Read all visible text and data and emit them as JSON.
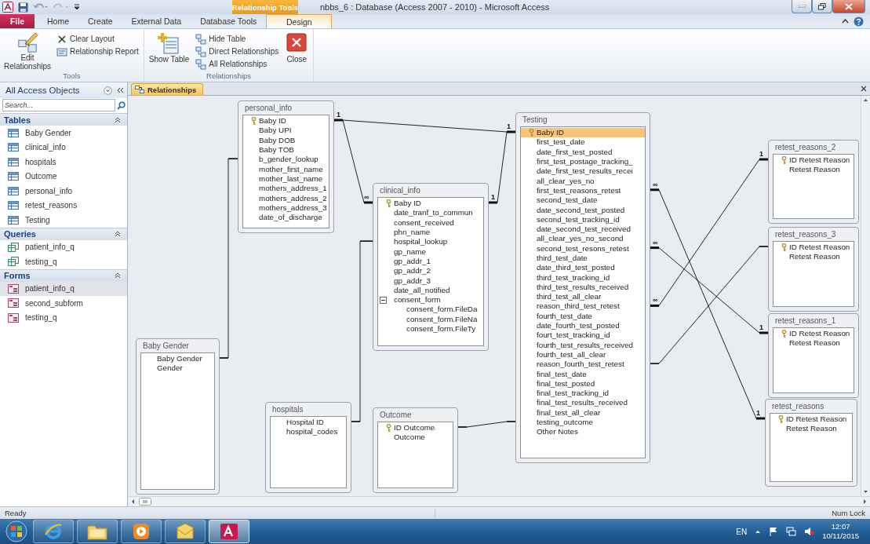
{
  "window": {
    "title": "nbbs_6 : Database (Access 2007 - 2010) - Microsoft Access",
    "context_tab_group": "Relationship Tools"
  },
  "ribbon_tabs": [
    {
      "label": "File",
      "kind": "file",
      "selected": false
    },
    {
      "label": "Home",
      "kind": "plain",
      "selected": false
    },
    {
      "label": "Create",
      "kind": "plain",
      "selected": false
    },
    {
      "label": "External Data",
      "kind": "plain",
      "selected": false
    },
    {
      "label": "Database Tools",
      "kind": "plain",
      "selected": false
    },
    {
      "label": "Design",
      "kind": "contextual",
      "selected": true
    }
  ],
  "ribbon_groups": [
    {
      "label": "Tools",
      "buttons": [
        {
          "label": "Edit Relationships",
          "kind": "large"
        },
        {
          "label": "Clear Layout",
          "kind": "small"
        },
        {
          "label": "Relationship Report",
          "kind": "small"
        }
      ]
    },
    {
      "label": "Relationships",
      "buttons": [
        {
          "label": "Show Table",
          "kind": "large"
        },
        {
          "label": "Hide Table",
          "kind": "small"
        },
        {
          "label": "Direct Relationships",
          "kind": "small"
        },
        {
          "label": "All Relationships",
          "kind": "small"
        },
        {
          "label": "Close",
          "kind": "large"
        }
      ]
    }
  ],
  "navigation": {
    "title": "All Access Objects",
    "search": {
      "placeholder": "Search..."
    },
    "groups": [
      {
        "label": "Tables",
        "kind": "table",
        "expanded": true,
        "items": [
          {
            "label": "Baby Gender",
            "selected": false
          },
          {
            "label": "clinical_info",
            "selected": false
          },
          {
            "label": "hospitals",
            "selected": false
          },
          {
            "label": "Outcome",
            "selected": false
          },
          {
            "label": "personal_info",
            "selected": false
          },
          {
            "label": "retest_reasons",
            "selected": false
          },
          {
            "label": "Testing",
            "selected": false
          }
        ]
      },
      {
        "label": "Queries",
        "kind": "query",
        "expanded": true,
        "items": [
          {
            "label": "patient_info_q",
            "selected": false
          },
          {
            "label": "testing_q",
            "selected": false
          }
        ]
      },
      {
        "label": "Forms",
        "kind": "form",
        "expanded": true,
        "items": [
          {
            "label": "patient_info_q",
            "selected": true
          },
          {
            "label": "second_subform",
            "selected": false
          },
          {
            "label": "testing_q",
            "selected": false
          }
        ]
      }
    ]
  },
  "document_tab": {
    "label": "Relationships"
  },
  "tables": [
    {
      "name": "personal_info",
      "fields": [
        {
          "name": "Baby ID",
          "key": true,
          "selected": false
        },
        {
          "name": "Baby UPI",
          "key": false,
          "selected": false
        },
        {
          "name": "Baby DOB",
          "key": false,
          "selected": false
        },
        {
          "name": "Baby TOB",
          "key": false,
          "selected": false
        },
        {
          "name": "b_gender_lookup",
          "key": false,
          "selected": false
        },
        {
          "name": "mother_first_name",
          "key": false,
          "selected": false
        },
        {
          "name": "mother_last_name",
          "key": false,
          "selected": false
        },
        {
          "name": "mothers_address_1",
          "key": false,
          "selected": false
        },
        {
          "name": "mothers_address_2",
          "key": false,
          "selected": false
        },
        {
          "name": "mothers_address_3",
          "key": false,
          "selected": false
        },
        {
          "name": "date_of_discharge",
          "key": false,
          "selected": false
        }
      ]
    },
    {
      "name": "Testing",
      "fields": [
        {
          "name": "Baby ID",
          "key": true,
          "selected": true
        },
        {
          "name": "first_test_date",
          "key": false,
          "selected": false
        },
        {
          "name": "date_first_test_posted",
          "key": false,
          "selected": false
        },
        {
          "name": "first_test_postage_tracking_",
          "key": false,
          "selected": false
        },
        {
          "name": "date_first_test_results_recei",
          "key": false,
          "selected": false
        },
        {
          "name": "all_clear_yes_no",
          "key": false,
          "selected": false
        },
        {
          "name": "first_test_reasons_retest",
          "key": false,
          "selected": false
        },
        {
          "name": "second_test_date",
          "key": false,
          "selected": false
        },
        {
          "name": "date_second_test_posted",
          "key": false,
          "selected": false
        },
        {
          "name": "second_test_tracking_id",
          "key": false,
          "selected": false
        },
        {
          "name": "date_second_test_received",
          "key": false,
          "selected": false
        },
        {
          "name": "all_clear_yes_no_second",
          "key": false,
          "selected": false
        },
        {
          "name": "second_test_resons_retest",
          "key": false,
          "selected": false
        },
        {
          "name": "third_test_date",
          "key": false,
          "selected": false
        },
        {
          "name": "date_third_test_posted",
          "key": false,
          "selected": false
        },
        {
          "name": "third_test_tracking_id",
          "key": false,
          "selected": false
        },
        {
          "name": "third_test_results_received",
          "key": false,
          "selected": false
        },
        {
          "name": "third_test_all_clear",
          "key": false,
          "selected": false
        },
        {
          "name": "reason_third_test_retest",
          "key": false,
          "selected": false
        },
        {
          "name": "fourth_test_date",
          "key": false,
          "selected": false
        },
        {
          "name": "date_fourth_test_posted",
          "key": false,
          "selected": false
        },
        {
          "name": "fourt_test_tracking_id",
          "key": false,
          "selected": false
        },
        {
          "name": "fourth_test_results_received",
          "key": false,
          "selected": false
        },
        {
          "name": "fourth_test_all_clear",
          "key": false,
          "selected": false
        },
        {
          "name": "reason_fourth_test_retest",
          "key": false,
          "selected": false
        },
        {
          "name": "final_test_date",
          "key": false,
          "selected": false
        },
        {
          "name": "final_test_posted",
          "key": false,
          "selected": false
        },
        {
          "name": "final_test_tracking_id",
          "key": false,
          "selected": false
        },
        {
          "name": "final_test_results_received",
          "key": false,
          "selected": false
        },
        {
          "name": "final_test_all_clear",
          "key": false,
          "selected": false
        },
        {
          "name": "testing_outcome",
          "key": false,
          "selected": false
        },
        {
          "name": "Other Notes",
          "key": false,
          "selected": false
        }
      ]
    },
    {
      "name": "retest_reasons_2",
      "fields": [
        {
          "name": "ID Retest Reason",
          "key": true,
          "selected": false
        },
        {
          "name": "Retest Reason",
          "key": false,
          "selected": false
        }
      ]
    },
    {
      "name": "clinical_info",
      "fields": [
        {
          "name": "Baby ID",
          "key": true,
          "selected": false
        },
        {
          "name": "date_tranf_to_commun",
          "key": false,
          "selected": false
        },
        {
          "name": "consent_received",
          "key": false,
          "selected": false
        },
        {
          "name": "phn_name",
          "key": false,
          "selected": false
        },
        {
          "name": "hospital_lookup",
          "key": false,
          "selected": false
        },
        {
          "name": "gp_name",
          "key": false,
          "selected": false
        },
        {
          "name": "gp_addr_1",
          "key": false,
          "selected": false
        },
        {
          "name": "gp_addr_2",
          "key": false,
          "selected": false
        },
        {
          "name": "gp_addr_3",
          "key": false,
          "selected": false
        },
        {
          "name": "date_all_notified",
          "key": false,
          "selected": false
        },
        {
          "name": "consent_form",
          "key": false,
          "selected": false,
          "expanded": true,
          "children": [
            {
              "name": "consent_form.FileDa",
              "key": false,
              "selected": false
            },
            {
              "name": "consent_form.FileNa",
              "key": false,
              "selected": false
            },
            {
              "name": "consent_form.FileTy",
              "key": false,
              "selected": false
            }
          ]
        }
      ]
    },
    {
      "name": "retest_reasons_3",
      "fields": [
        {
          "name": "ID Retest Reason",
          "key": true,
          "selected": false
        },
        {
          "name": "Retest Reason",
          "key": false,
          "selected": false
        }
      ]
    },
    {
      "name": "retest_reasons_1",
      "fields": [
        {
          "name": "ID Retest Reason",
          "key": true,
          "selected": false
        },
        {
          "name": "Retest Reason",
          "key": false,
          "selected": false
        }
      ]
    },
    {
      "name": "Baby Gender",
      "fields": [
        {
          "name": "Baby Gender",
          "key": false,
          "selected": false
        },
        {
          "name": "Gender",
          "key": false,
          "selected": false
        }
      ]
    },
    {
      "name": "hospitals",
      "fields": [
        {
          "name": "Hospital ID",
          "key": false,
          "selected": false
        },
        {
          "name": "hospital_codes",
          "key": false,
          "selected": false
        }
      ]
    },
    {
      "name": "Outcome",
      "fields": [
        {
          "name": "ID Outcome",
          "key": true,
          "selected": false
        },
        {
          "name": "Outcome",
          "key": false,
          "selected": false
        }
      ]
    },
    {
      "name": "retest_reasons",
      "fields": [
        {
          "name": "ID Retest Reason",
          "key": true,
          "selected": false
        },
        {
          "name": "Retest Reason",
          "key": false,
          "selected": false
        }
      ]
    }
  ],
  "relationships": [
    {
      "kind": "straight"
    },
    {
      "kind": "straight"
    },
    {
      "kind": "straight"
    },
    {
      "kind": "orthogonal"
    },
    {
      "kind": "orthogonal"
    },
    {
      "kind": "straight"
    },
    {
      "kind": "straight"
    },
    {
      "kind": "straight"
    },
    {
      "kind": "straight"
    },
    {
      "kind": "straight"
    }
  ],
  "cardinality_labels": [
    "1",
    "1",
    "1",
    "∞",
    "∞",
    "1",
    "∞",
    "∞",
    "1",
    "1"
  ],
  "status_bar": {
    "left": "Ready",
    "right": "Num Lock"
  },
  "taskbar": {
    "apps": [
      {
        "kind": "browser",
        "active": false
      },
      {
        "kind": "folder",
        "active": false
      },
      {
        "kind": "media",
        "active": false
      },
      {
        "kind": "mail",
        "active": false
      },
      {
        "kind": "database",
        "active": true
      }
    ],
    "tray": {
      "language": "EN",
      "time": "12:07",
      "date": "10/11/2015"
    }
  }
}
